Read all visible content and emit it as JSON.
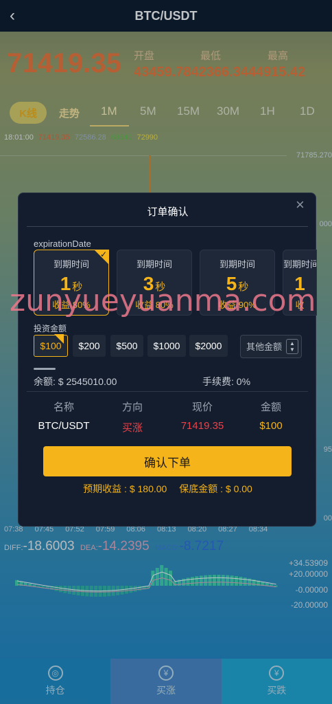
{
  "header": {
    "back_icon": "back-chevron-icon",
    "title": "BTC/USDT"
  },
  "ticker": {
    "price": "71419.35",
    "open_label": "开盘",
    "low_label": "最低",
    "high_label": "最高",
    "stats_text": "43459.7842366.3444915.42"
  },
  "period_tabs": {
    "kline": "K线",
    "trend": "走势",
    "items": [
      "1M",
      "5M",
      "15M",
      "30M",
      "1H",
      "1D"
    ],
    "active": "1M"
  },
  "ma_row": {
    "time": "18:01:00",
    "v1": "71419.35",
    "v2": "72586.28",
    "v3": "68640",
    "v4": "72990"
  },
  "chart": {
    "price_ticks": [
      "71785.270",
      "000",
      "95",
      "00"
    ],
    "time_ticks": [
      "07:38",
      "07:45",
      "07:52",
      "07:59",
      "08:06",
      "08:13",
      "08:20",
      "08:27",
      "08:34"
    ],
    "diff_label": "DIFF:",
    "diff_value": "-18.6003",
    "dea_label": "DEA:",
    "dea_value": "-14.2395",
    "macd_label": "MACD:",
    "macd_value": "-8.7217",
    "macd_scale": [
      "+34.53909",
      "+20.00000",
      "-0.00000",
      "-20.00000"
    ]
  },
  "bottom_nav": {
    "hold": "持仓",
    "buy_up": "买涨",
    "buy_down": "买跌"
  },
  "modal": {
    "title": "订单确认",
    "close_icon": "close-icon",
    "expiration_label": "expirationDate",
    "expiry_options": [
      {
        "title": "到期时间",
        "value": "1",
        "unit": "秒",
        "profit": "收益 80%"
      },
      {
        "title": "到期时间",
        "value": "3",
        "unit": "秒",
        "profit": "收益 80%"
      },
      {
        "title": "到期时间",
        "value": "5",
        "unit": "秒",
        "profit": "收益 90%"
      },
      {
        "title": "到期时间",
        "value": "1",
        "unit": "",
        "profit": "收"
      }
    ],
    "invest_label": "投资金额",
    "amounts": [
      "$100",
      "$200",
      "$500",
      "$1000",
      "$2000"
    ],
    "other_amount_placeholder": "其他金额",
    "balance": "余额: $ 2545010.00",
    "fee": "手续费: 0%",
    "columns": {
      "headers": [
        "名称",
        "方向",
        "现价",
        "金额"
      ],
      "values": [
        "BTC/USDT",
        "买涨",
        "71419.35",
        "$100"
      ]
    },
    "confirm_button": "确认下单",
    "expected_profit": "预期收益 : $ 180.00",
    "guarantee": "保底金额 : $ 0.00"
  },
  "watermark": "zunyueyuanma.com",
  "colors": {
    "accent": "#f4b41a",
    "price_orange": "#f0793b",
    "up_red": "#e8424a",
    "modal_bg": "#141d2d"
  }
}
